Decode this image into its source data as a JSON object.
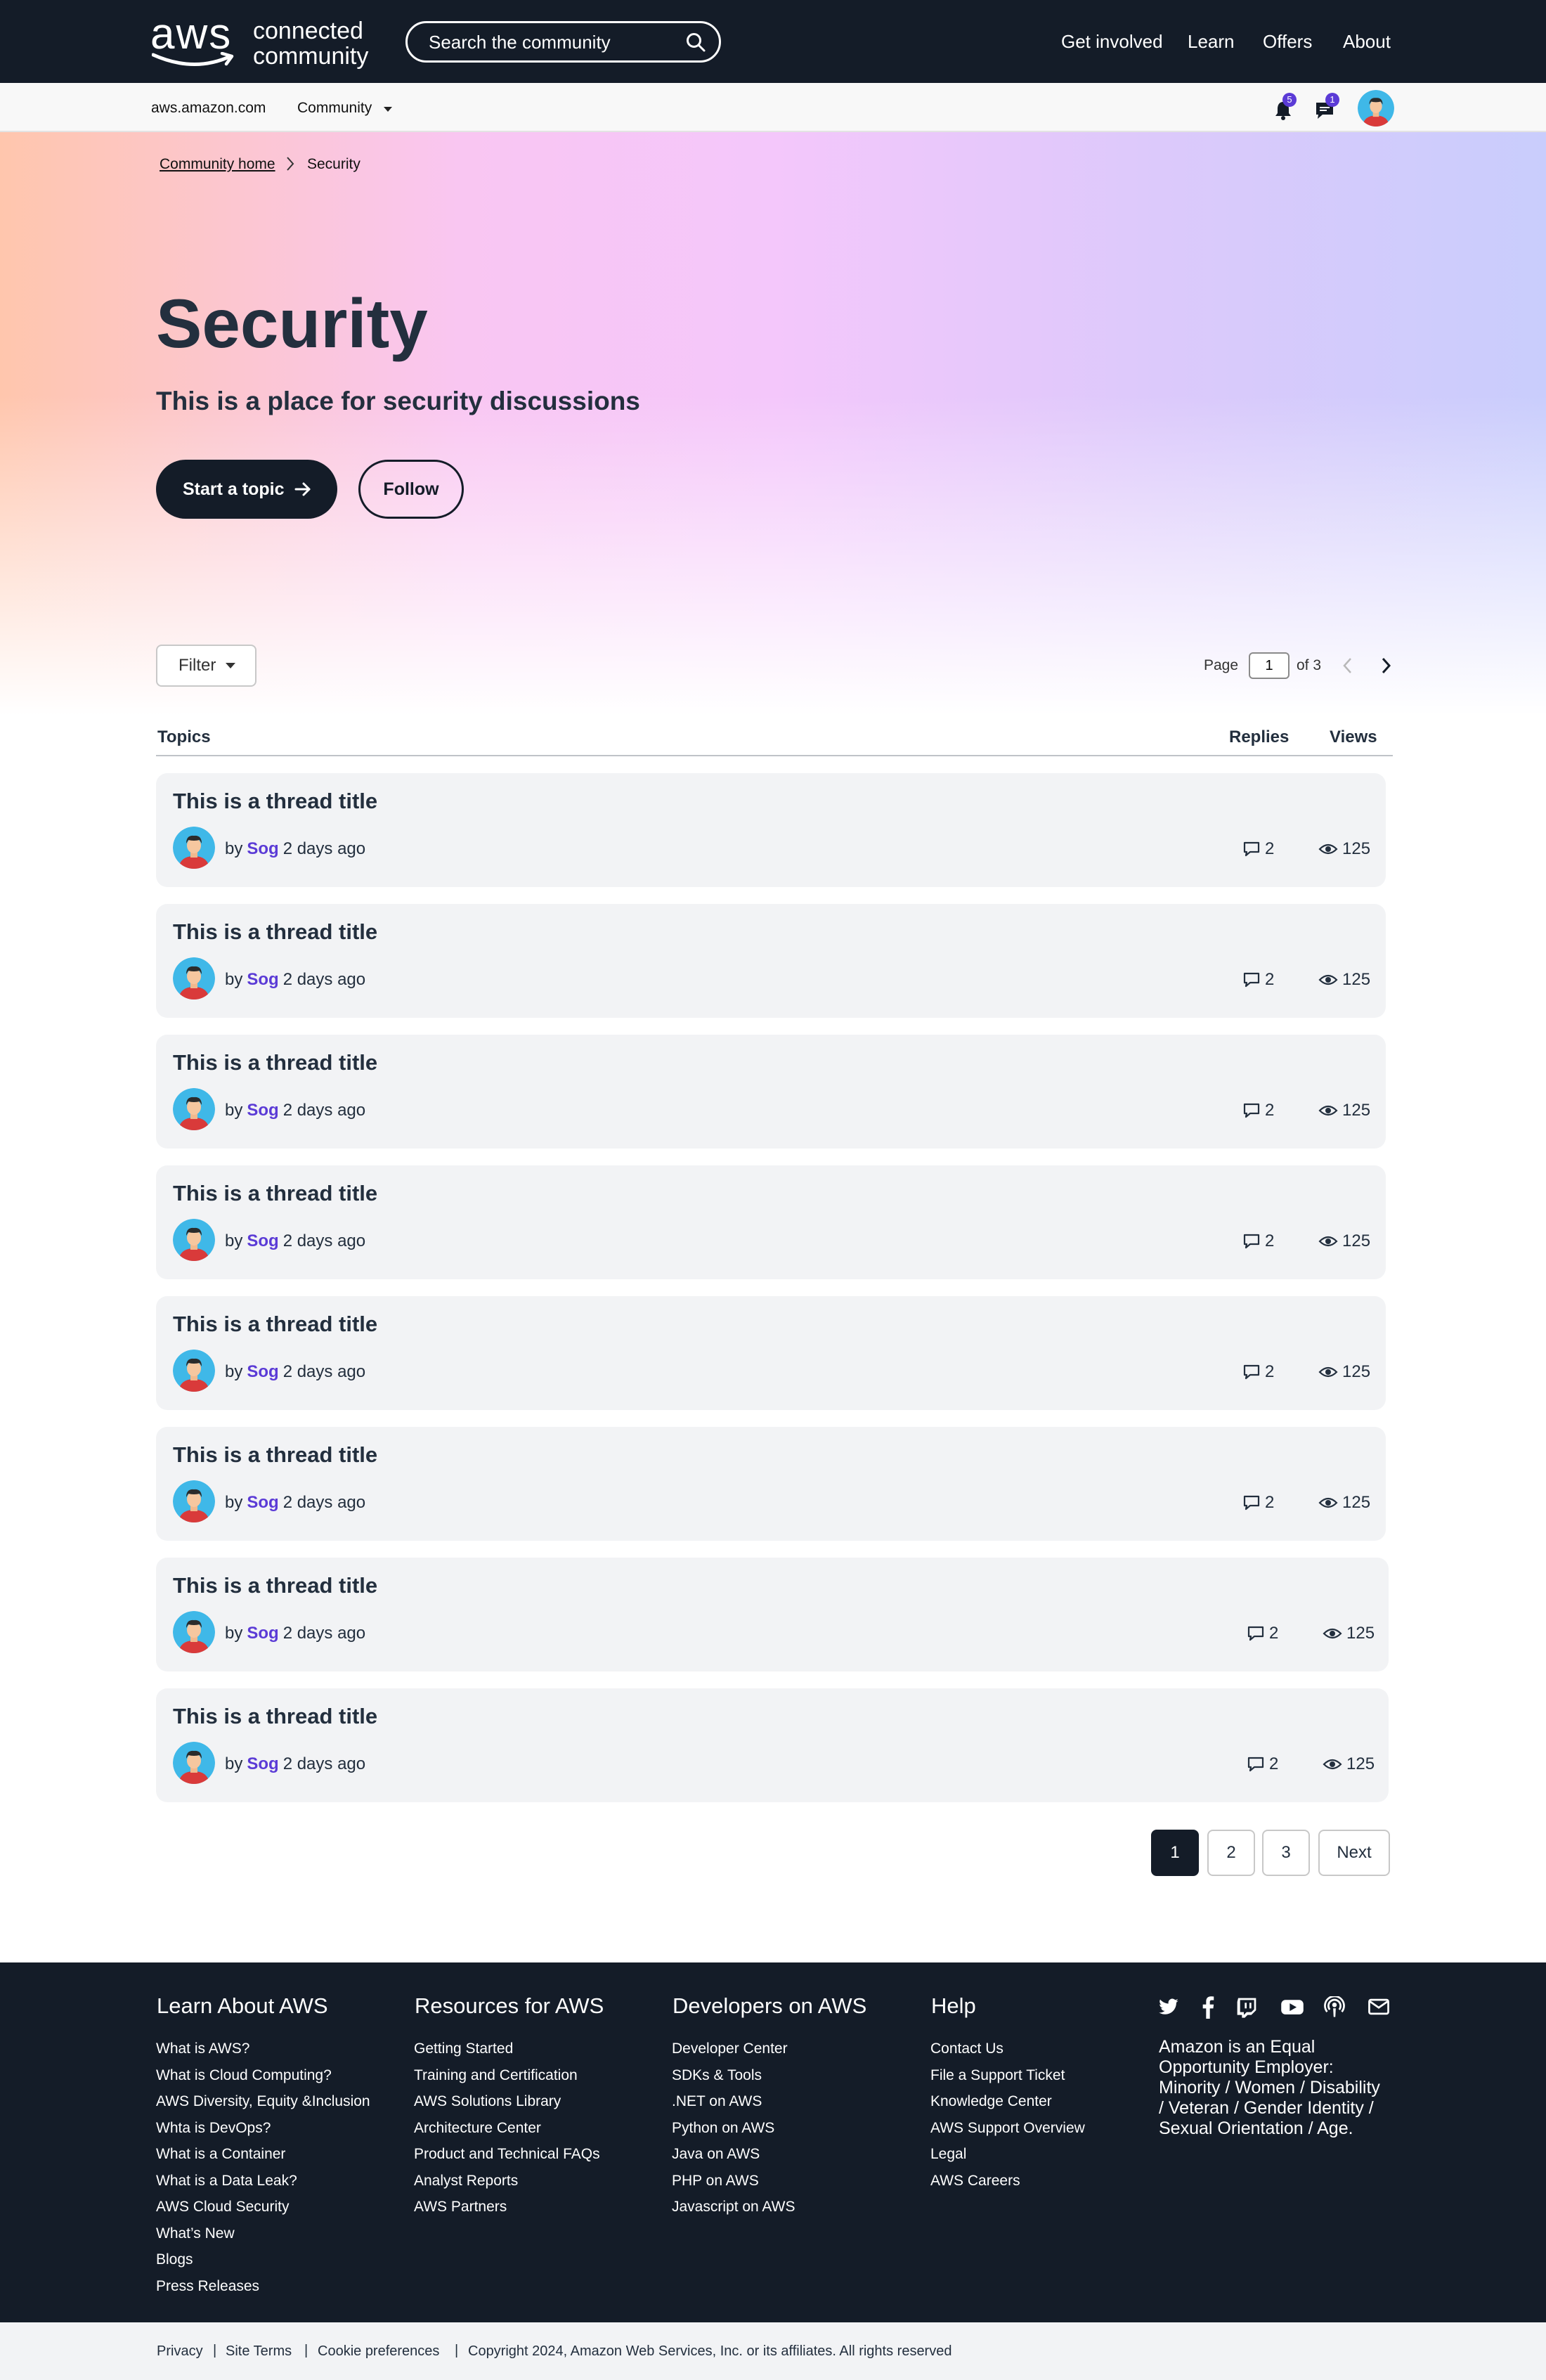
{
  "header": {
    "logo_aws": "aws",
    "logo_line1": "connected",
    "logo_line2": "community",
    "search_placeholder": "Search the community",
    "nav": [
      "Get involved",
      "Learn",
      "Offers",
      "About"
    ]
  },
  "subnav": {
    "home_link": "aws.amazon.com",
    "community_menu": "Community",
    "notifications_count": "5",
    "messages_count": "1"
  },
  "breadcrumb": {
    "home": "Community home",
    "current": "Security"
  },
  "hero": {
    "title": "Security",
    "subtitle": "This is a place for security discussions",
    "start_topic": "Start a topic",
    "follow": "Follow"
  },
  "toolbar": {
    "filter": "Filter",
    "page_label": "Page",
    "page_value": "1",
    "page_of": "of 3"
  },
  "table": {
    "col_topics": "Topics",
    "col_replies": "Replies",
    "col_views": "Views"
  },
  "topics": [
    {
      "title": "This is a thread title",
      "by": "by",
      "author": "Sog",
      "time": "2 days ago",
      "replies": "2",
      "views": "125"
    },
    {
      "title": "This is a thread title",
      "by": "by",
      "author": "Sog",
      "time": "2 days ago",
      "replies": "2",
      "views": "125"
    },
    {
      "title": "This is a thread title",
      "by": "by",
      "author": "Sog",
      "time": "2 days ago",
      "replies": "2",
      "views": "125"
    },
    {
      "title": "This is a thread title",
      "by": "by",
      "author": "Sog",
      "time": "2 days ago",
      "replies": "2",
      "views": "125"
    },
    {
      "title": "This is a thread title",
      "by": "by",
      "author": "Sog",
      "time": "2 days ago",
      "replies": "2",
      "views": "125"
    },
    {
      "title": "This is a thread title",
      "by": "by",
      "author": "Sog",
      "time": "2 days ago",
      "replies": "2",
      "views": "125"
    },
    {
      "title": "This is a thread title",
      "by": "by",
      "author": "Sog",
      "time": "2 days ago",
      "replies": "2",
      "views": "125"
    },
    {
      "title": "This is a thread title",
      "by": "by",
      "author": "Sog",
      "time": "2 days ago",
      "replies": "2",
      "views": "125"
    }
  ],
  "pagination": {
    "pages": [
      "1",
      "2",
      "3"
    ],
    "next": "Next",
    "active": "1"
  },
  "footer": {
    "columns": [
      {
        "title": "Learn About AWS",
        "links": [
          "What is AWS?",
          "What is Cloud Computing?",
          "AWS Diversity, Equity &Inclusion",
          "Whta is DevOps?",
          "What is a Container",
          "What is a Data Leak?",
          "AWS Cloud Security",
          "What’s New",
          "Blogs",
          "Press Releases"
        ]
      },
      {
        "title": "Resources for AWS",
        "links": [
          "Getting Started",
          "Training and Certification",
          "AWS Solutions Library",
          "Architecture Center",
          "Product and Technical FAQs",
          "Analyst Reports",
          "AWS Partners"
        ]
      },
      {
        "title": "Developers on AWS",
        "links": [
          "Developer Center",
          "SDKs & Tools",
          ".NET on AWS",
          "Python on AWS",
          "Java on AWS",
          "PHP on AWS",
          "Javascript on AWS"
        ]
      },
      {
        "title": "Help",
        "links": [
          "Contact Us",
          "File a Support Ticket",
          "Knowledge Center",
          "AWS Support Overview",
          "Legal",
          "AWS Careers"
        ]
      }
    ],
    "social_icons": [
      "twitter-icon",
      "facebook-icon",
      "twitch-icon",
      "youtube-icon",
      "podcast-icon",
      "email-icon"
    ],
    "equal_opportunity": "Amazon is an Equal Opportunity Employer: Minority / Women / Disability / Veteran / Gender Identity / Sexual Orientation / Age."
  },
  "bottom": {
    "privacy": "Privacy",
    "site_terms": "Site Terms",
    "cookies": "Cookie preferences",
    "copyright": "Copyright 2024, Amazon Web Services, Inc. or its affiliates. All rights reserved",
    "separator": "|"
  },
  "colors": {
    "navy": "#141c28",
    "accent_purple": "#5b3bd6",
    "card_bg": "#f2f3f5"
  }
}
